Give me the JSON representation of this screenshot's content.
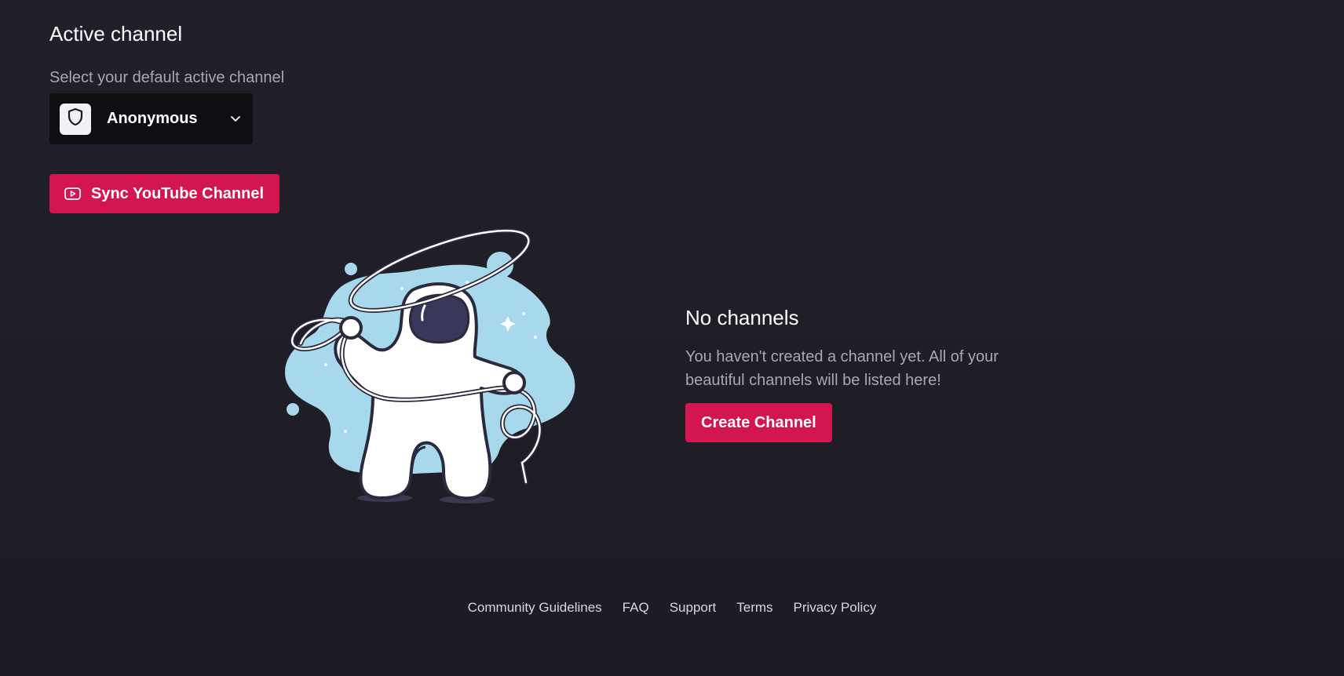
{
  "active_channel": {
    "title": "Active channel",
    "select_label": "Select your default active channel",
    "selected_channel": "Anonymous",
    "avatar_icon": "shield-icon",
    "dropdown_icon": "chevron-down-icon"
  },
  "sync_button": {
    "label": "Sync YouTube Channel",
    "icon": "youtube-icon"
  },
  "empty_state": {
    "illustration": "astronaut-with-lasso",
    "title": "No channels",
    "message": "You haven't created a channel yet. All of your beautiful channels will be listed here!",
    "create_button": "Create Channel"
  },
  "footer": {
    "links": [
      "Community Guidelines",
      "FAQ",
      "Support",
      "Terms",
      "Privacy Policy"
    ]
  },
  "colors": {
    "background": "#1f1d26",
    "accent": "#d3164f",
    "select_background": "#0f0e13",
    "muted_text": "#a9a6b3",
    "illustration_blue": "#a8d8ec"
  }
}
